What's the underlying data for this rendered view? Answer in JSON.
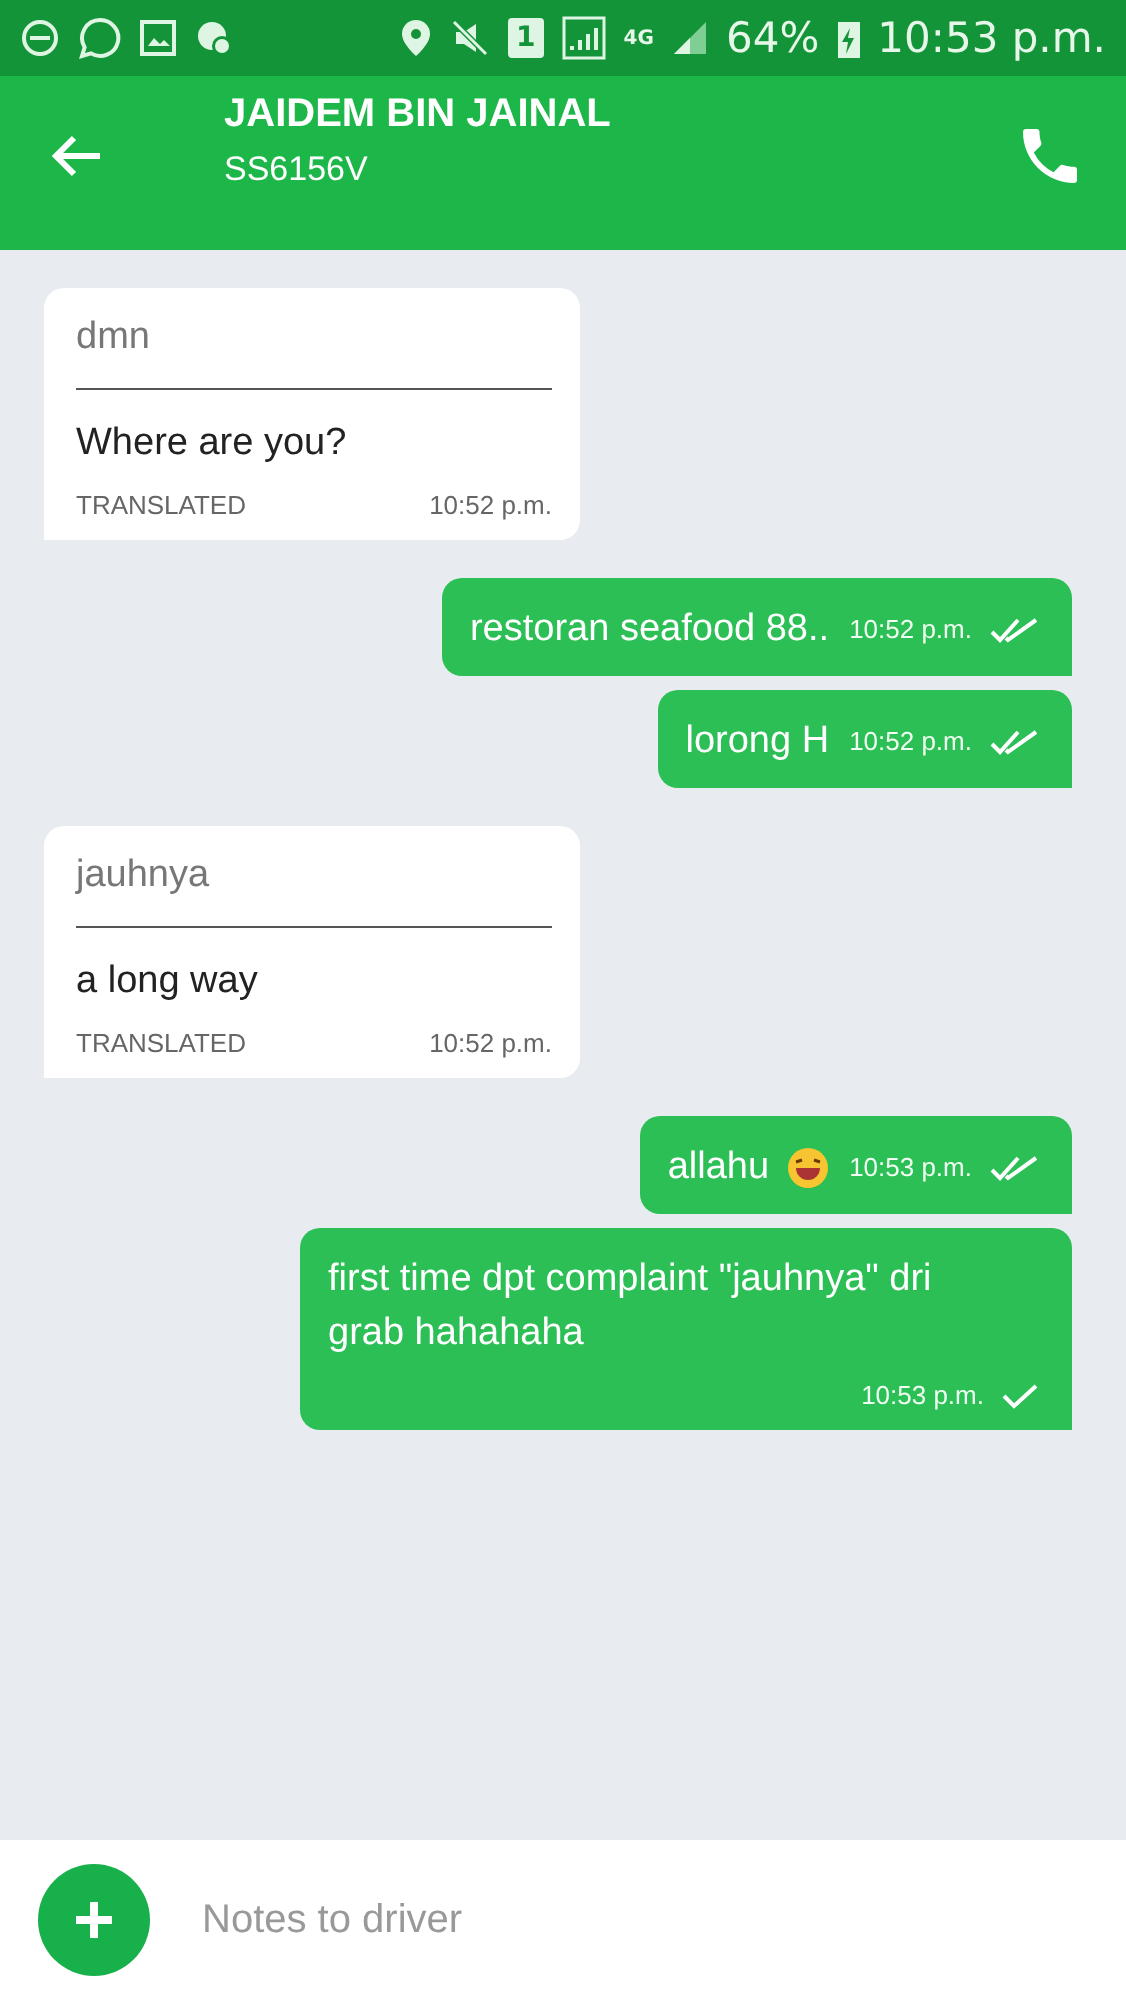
{
  "status_bar": {
    "sim": "1",
    "network": "4G",
    "battery": "64%",
    "time": "10:53 p.m."
  },
  "header": {
    "name": "JAIDEM BIN JAINAL",
    "plate": "SS6156V"
  },
  "messages": [
    {
      "kind": "incoming",
      "original": "dmn",
      "text": "Where are you?",
      "label": "TRANSLATED",
      "time": "10:52 p.m."
    },
    {
      "kind": "outgoing",
      "text": "restoran seafood 88..",
      "time": "10:52 p.m.",
      "read": true
    },
    {
      "kind": "outgoing",
      "text": "lorong H",
      "time": "10:52 p.m.",
      "read": true
    },
    {
      "kind": "incoming",
      "original": "jauhnya",
      "text": "a long way",
      "label": "TRANSLATED",
      "time": "10:52 p.m."
    },
    {
      "kind": "outgoing",
      "text": "allahu",
      "emoji": true,
      "time": "10:53 p.m.",
      "read": true
    },
    {
      "kind": "outgoing",
      "text": "first time dpt complaint \"jauhnya\" dri grab hahahaha",
      "wide": true,
      "time": "10:53 p.m.",
      "read": false
    }
  ],
  "composer": {
    "placeholder": "Notes to driver"
  }
}
